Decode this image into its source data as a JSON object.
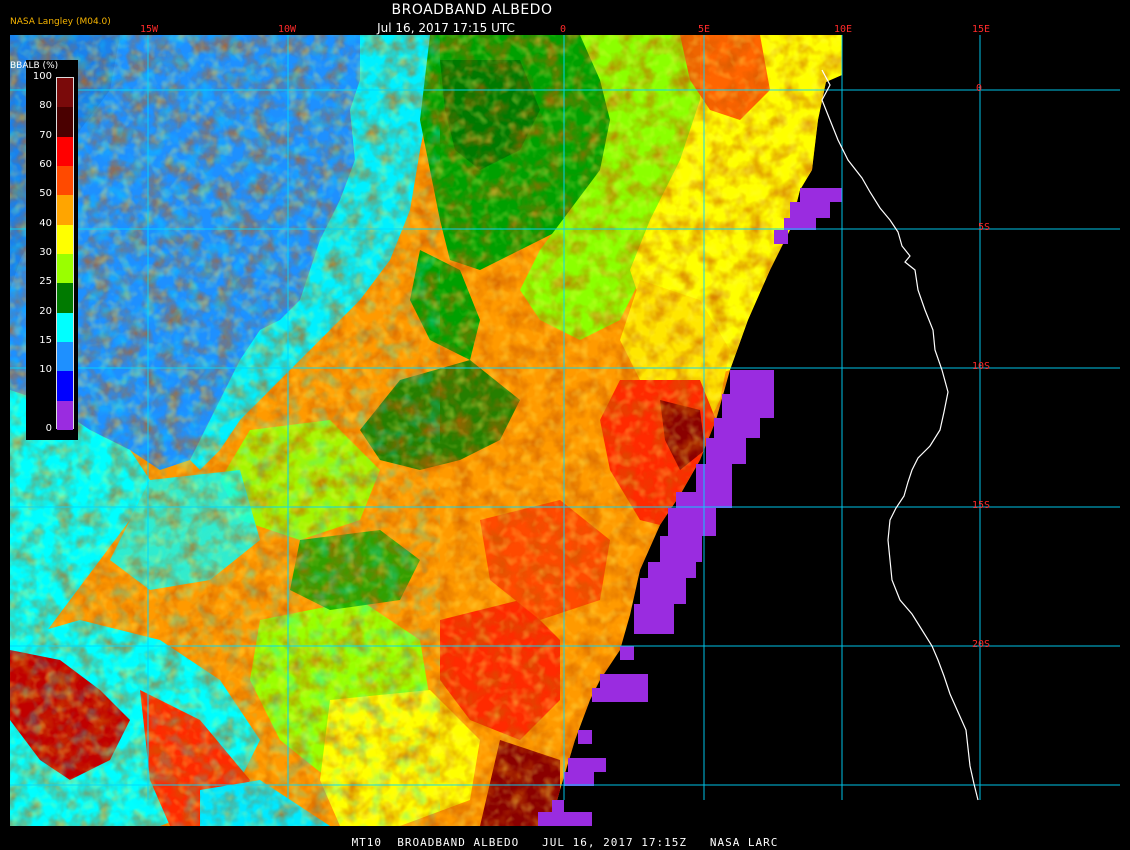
{
  "header": {
    "title": "BROADBAND ALBEDO",
    "subtitle": "Jul 16, 2017 17:15 UTC",
    "credit": "NASA Langley (M04.0)"
  },
  "footer": {
    "text": "MT10  BROADBAND ALBEDO   JUL 16, 2017 17:15Z   NASA LARC"
  },
  "legend": {
    "title": "BBALB (%)",
    "ticks": [
      "100",
      "80",
      "70",
      "60",
      "50",
      "40",
      "30",
      "25",
      "20",
      "15",
      "10",
      "0"
    ],
    "colors": [
      "#7a0a0a",
      "#4a0000",
      "#ff0000",
      "#ff4a00",
      "#ffa500",
      "#ffff00",
      "#9aff00",
      "#007a00",
      "#00ffff",
      "#1e90ff",
      "#0000ff",
      "#9a2ce0"
    ]
  },
  "grid": {
    "lon_labels": [
      "15W",
      "10W",
      "0",
      "5E",
      "10E",
      "15E"
    ],
    "lat_labels": [
      "0",
      "5S",
      "10S",
      "15S",
      "20S"
    ],
    "line_color": "#00d8ff",
    "label_color": "#ff2a2a"
  },
  "colors": {
    "background": "#000000",
    "coast": "#ffffff"
  }
}
